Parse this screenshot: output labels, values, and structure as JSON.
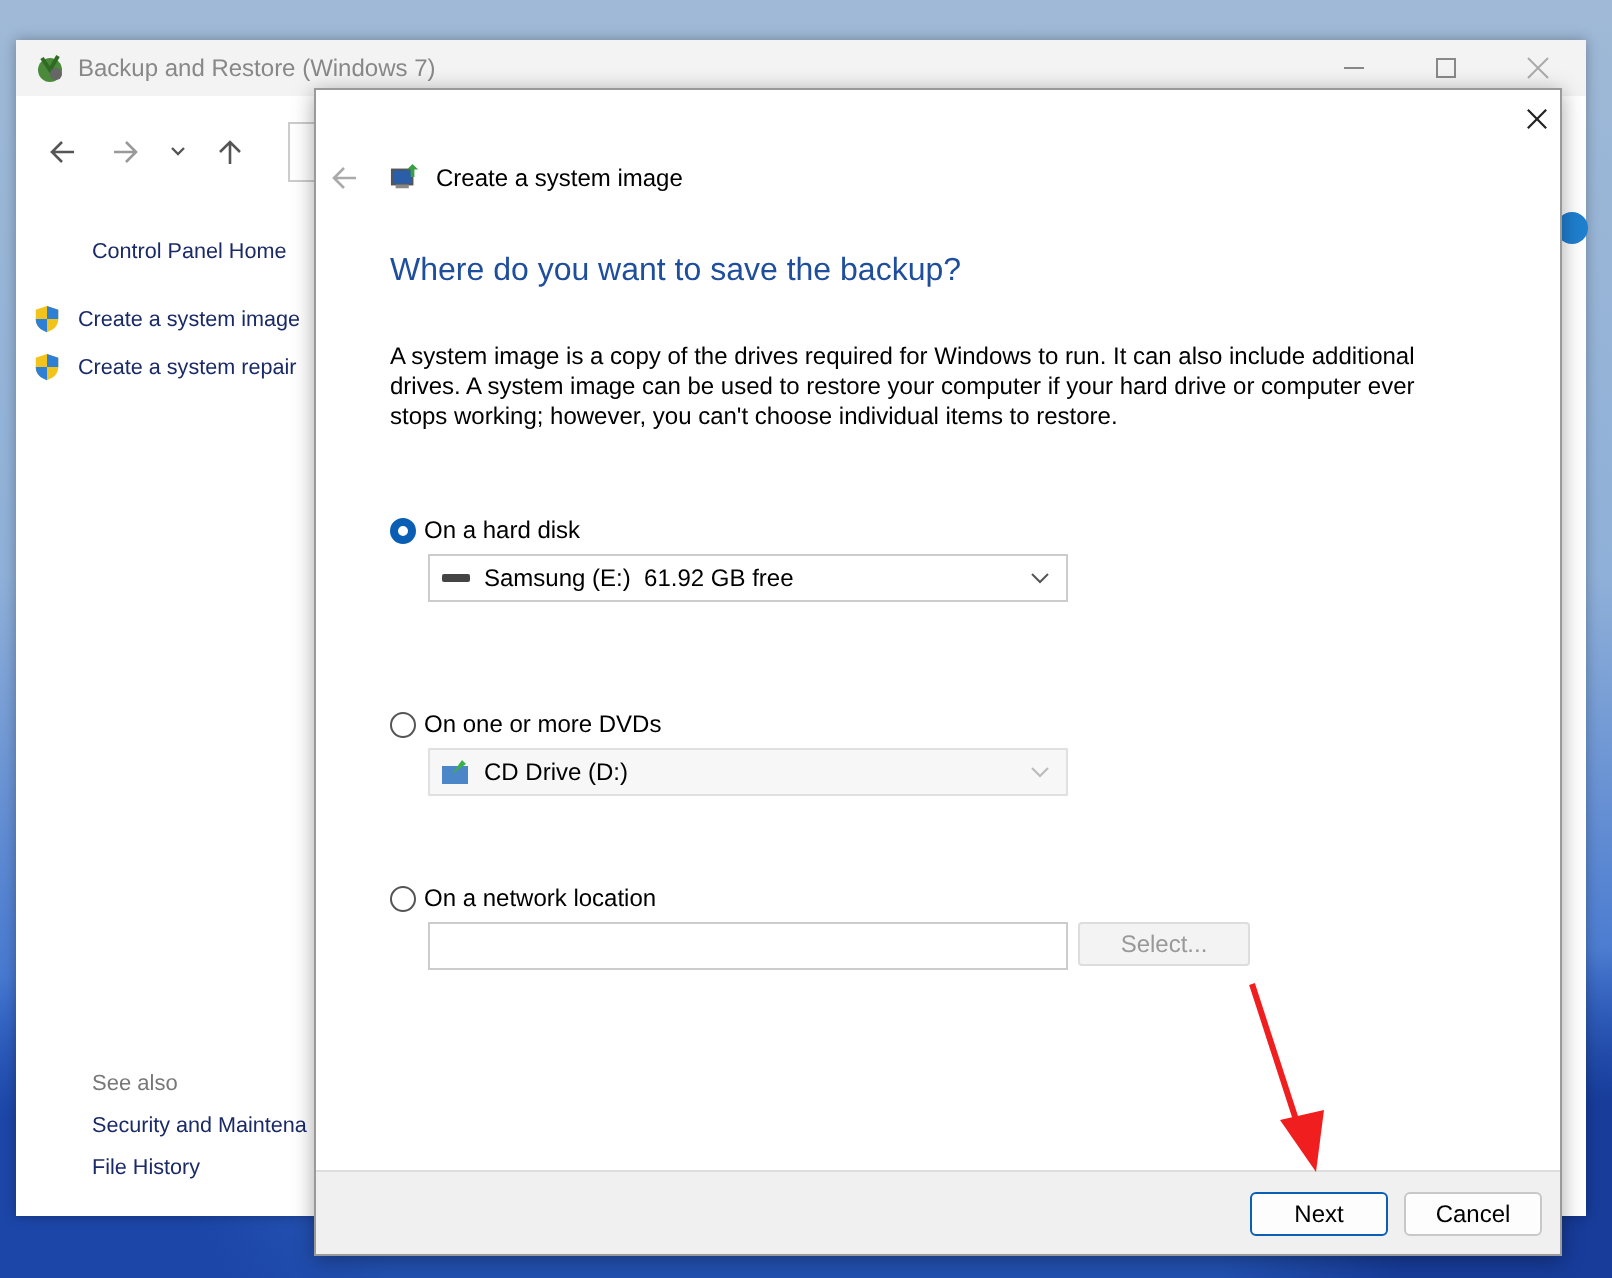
{
  "back_window": {
    "title": "Backup and Restore (Windows 7)",
    "sidebar": {
      "home_link": "Control Panel Home",
      "tasks": [
        "Create a system image",
        "Create a system repair"
      ],
      "see_also_heading": "See also",
      "see_also": [
        "Security and Maintena",
        "File History"
      ]
    }
  },
  "dialog": {
    "title": "Create a system image",
    "heading": "Where do you want to save the backup?",
    "description": "A system image is a copy of the drives required for Windows to run. It can also include additional drives. A system image can be used to restore your computer if your hard drive or computer ever stops working; however, you can't choose individual items to restore.",
    "options": [
      {
        "kind": "hard-disk",
        "label": "On a hard disk",
        "selected": true,
        "value": "Samsung (E:)  61.92 GB free",
        "disabled": false
      },
      {
        "kind": "dvd",
        "label": "On one or more DVDs",
        "selected": false,
        "value": "CD Drive (D:)",
        "disabled": true
      },
      {
        "kind": "network",
        "label": "On a network location",
        "selected": false,
        "button": "Select...",
        "disabled": true
      }
    ],
    "buttons": [
      {
        "label": "Next",
        "default": true
      },
      {
        "label": "Cancel",
        "default": false
      }
    ]
  }
}
